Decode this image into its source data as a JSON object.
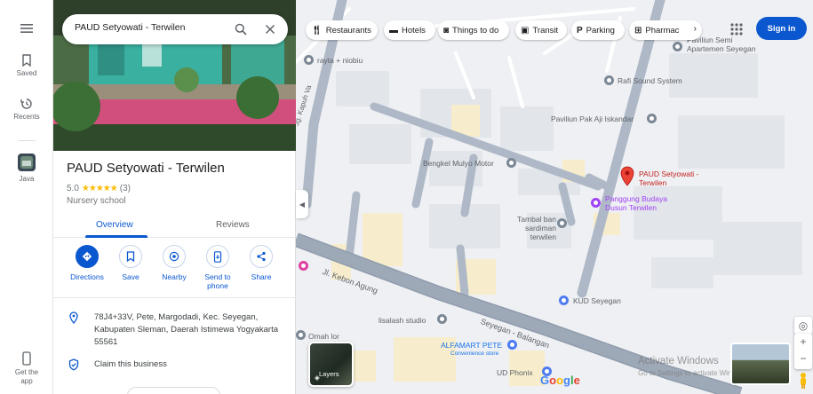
{
  "rail": {
    "items": [
      {
        "label": "Saved"
      },
      {
        "label": "Recents"
      },
      {
        "label": "Java"
      },
      {
        "label": "Get the app"
      }
    ]
  },
  "search": {
    "value": "PAUD Setyowati - Terwilen"
  },
  "chips": [
    {
      "label": "Restaurants",
      "icon": "fork-knife-icon"
    },
    {
      "label": "Hotels",
      "icon": "bed-icon"
    },
    {
      "label": "Things to do",
      "icon": "camera-icon"
    },
    {
      "label": "Transit",
      "icon": "train-icon"
    },
    {
      "label": "Parking",
      "icon": "parking-icon"
    },
    {
      "label": "Pharmac",
      "icon": "pharmacy-icon"
    }
  ],
  "header": {
    "signin_label": "Sign in"
  },
  "place": {
    "title": "PAUD Setyowati - Terwilen",
    "rating": "5.0",
    "rating_stars": "★★★★★",
    "review_count": "(3)",
    "category": "Nursery school"
  },
  "tabs": [
    {
      "label": "Overview",
      "active": true
    },
    {
      "label": "Reviews",
      "active": false
    }
  ],
  "actions": [
    {
      "label": "Directions",
      "icon": "directions-icon"
    },
    {
      "label": "Save",
      "icon": "bookmark-icon"
    },
    {
      "label": "Nearby",
      "icon": "nearby-icon"
    },
    {
      "label": "Send to phone",
      "icon": "phone-icon"
    },
    {
      "label": "Share",
      "icon": "share-icon"
    }
  ],
  "info": {
    "address": "78J4+33V, Pete, Margodadi, Kec. Seyegan, Kabupaten Sleman, Daerah Istimewa Yogyakarta 55561",
    "claim": "Claim this business"
  },
  "map": {
    "labels": {
      "paviliun_semi": "Paviliun Semi Apartemen Seyegan",
      "rafi_sound": "Rafi Sound System",
      "paviliun_pak_aji": "Paviliun Pak Aji Iskandar",
      "bengkel": "Bengkel Mulyo Motor",
      "paud": "PAUD Setyowati - Terwilen",
      "panggung": "Panggung Budaya Dusun Terwilen",
      "tambal": "Tambal ban sardiman terwilen",
      "kud": "KUD Seyegan",
      "lisalash": "lisalash studio",
      "alfamart": "ALFAMART PETE",
      "alfamart_sub": "Convenience store",
      "ud_phonix": "UD Phonix",
      "omah": "Omah lor",
      "rayta": "rayta + niobiu",
      "road_kebon": "Jl. Kebon Agung",
      "road_seyegan": "Seyegan - Balangan",
      "road_kepuh": "Jg. Kapuh Va"
    },
    "layers_label": "Layers",
    "watermark": "Activate Windows",
    "watermark_sub": "Go to Settings to activate Windows.",
    "zoom_in": "+",
    "zoom_out": "−"
  }
}
